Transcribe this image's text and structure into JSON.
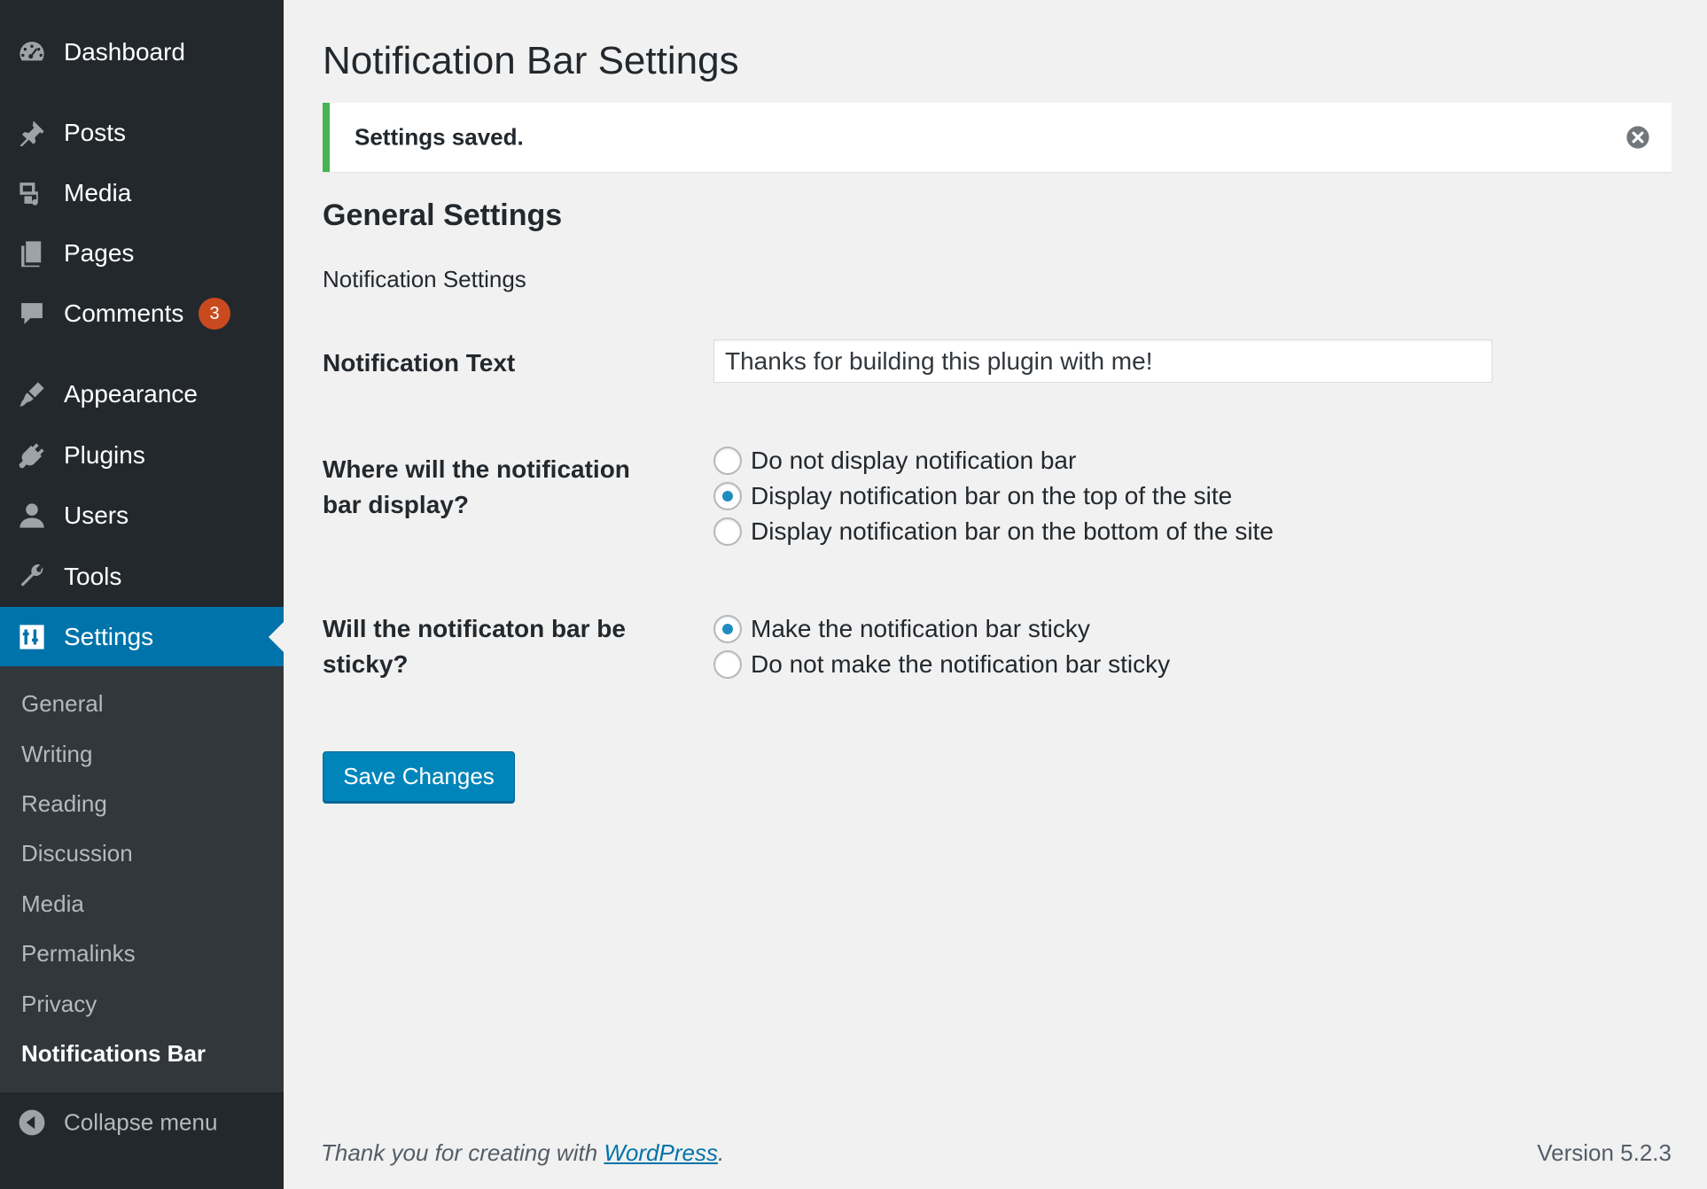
{
  "sidebar": {
    "menu": [
      {
        "label": "Dashboard",
        "icon": "dashboard-icon"
      },
      {
        "label": "Posts",
        "icon": "pin-icon"
      },
      {
        "label": "Media",
        "icon": "media-icon"
      },
      {
        "label": "Pages",
        "icon": "pages-icon"
      },
      {
        "label": "Comments",
        "icon": "comment-icon",
        "badge": "3"
      },
      {
        "label": "Appearance",
        "icon": "brush-icon"
      },
      {
        "label": "Plugins",
        "icon": "plug-icon"
      },
      {
        "label": "Users",
        "icon": "user-icon"
      },
      {
        "label": "Tools",
        "icon": "wrench-icon"
      },
      {
        "label": "Settings",
        "icon": "settings-icon",
        "active": true
      }
    ],
    "submenu": [
      {
        "label": "General"
      },
      {
        "label": "Writing"
      },
      {
        "label": "Reading"
      },
      {
        "label": "Discussion"
      },
      {
        "label": "Media"
      },
      {
        "label": "Permalinks"
      },
      {
        "label": "Privacy"
      },
      {
        "label": "Notifications Bar",
        "current": true
      }
    ],
    "collapse_label": "Collapse menu"
  },
  "main": {
    "title": "Notification Bar Settings",
    "notice": "Settings saved.",
    "section_title": "General Settings",
    "section_desc": "Notification Settings",
    "fields": {
      "notification_text": {
        "label": "Notification Text",
        "value": "Thanks for building this plugin with me!"
      },
      "display_location": {
        "label_line1": "Where will the notification",
        "label_line2": "bar display?",
        "options": [
          {
            "label": "Do not display notification bar",
            "checked": false
          },
          {
            "label": "Display notification bar on the top of the site",
            "checked": true
          },
          {
            "label": "Display notification bar on the bottom of the site",
            "checked": false
          }
        ]
      },
      "sticky": {
        "label_line1": "Will the notificaton bar be",
        "label_line2": "sticky?",
        "options": [
          {
            "label": "Make the notification bar sticky",
            "checked": true
          },
          {
            "label": "Do not make the notification bar sticky",
            "checked": false
          }
        ]
      }
    },
    "save_label": "Save Changes"
  },
  "footer": {
    "thanks_prefix": "Thank you for creating with ",
    "thanks_link": "WordPress",
    "thanks_suffix": ".",
    "version": "Version 5.2.3"
  },
  "colors": {
    "sidebar_bg": "#23282d",
    "submenu_bg": "#32373c",
    "accent": "#0073aa",
    "notice_success": "#46b450",
    "badge": "#ca4a1f"
  }
}
